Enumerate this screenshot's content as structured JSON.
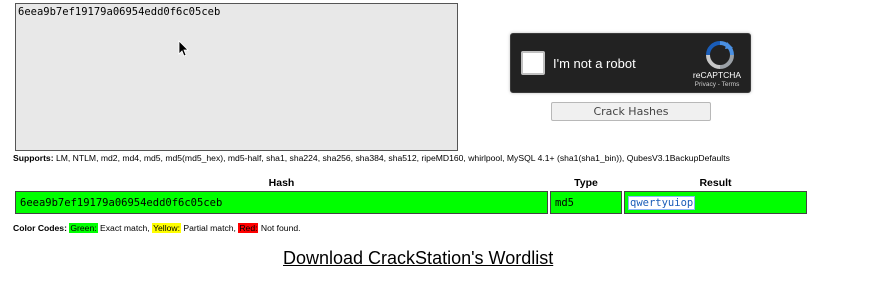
{
  "input": {
    "hash_text": "6eea9b7ef19179a06954edd0f6c05ceb"
  },
  "captcha": {
    "label": "I'm not a robot",
    "brand": "reCAPTCHA",
    "links": "Privacy - Terms"
  },
  "crack_button": "Crack Hashes",
  "supports": {
    "label": "Supports:",
    "list": "LM, NTLM, md2, md4, md5, md5(md5_hex), md5-half, sha1, sha224, sha256, sha384, sha512, ripeMD160, whirlpool, MySQL 4.1+ (sha1(sha1_bin)), QubesV3.1BackupDefaults"
  },
  "table": {
    "headers": [
      "Hash",
      "Type",
      "Result"
    ],
    "rows": [
      {
        "hash": "6eea9b7ef19179a06954edd0f6c05ceb",
        "type": "md5",
        "result": "qwertyuiop",
        "status_color": "#00ff00"
      }
    ]
  },
  "color_codes": {
    "label": "Color Codes:",
    "green": "Green:",
    "green_desc": "Exact match,",
    "yellow": "Yellow:",
    "yellow_desc": "Partial match,",
    "red": "Red:",
    "red_desc": "Not found."
  },
  "wordlist_link": "Download CrackStation's Wordlist",
  "icons": {
    "cursor": "mouse-pointer-icon",
    "recaptcha": "recaptcha-logo-icon"
  }
}
